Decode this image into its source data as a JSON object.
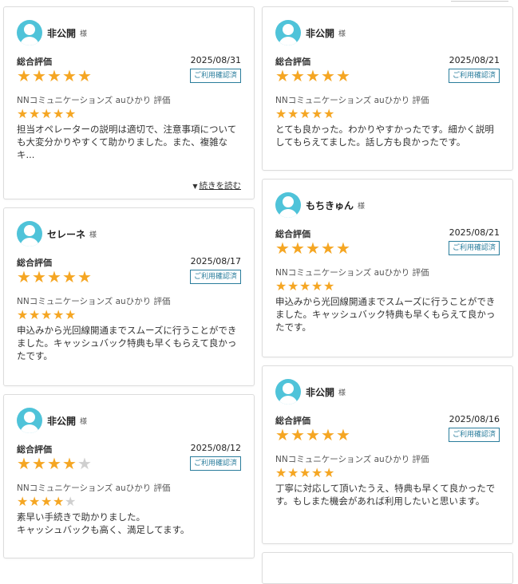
{
  "honorific": "様",
  "overall_label": "総合評価",
  "confirmed_badge": "ご利用確認済",
  "service_rating_label": "NNコミュニケーションズ auひかり 評価",
  "read_more": "続きを読む",
  "star_color": "#f5a623",
  "avatar_color": "#4fc3d9",
  "reviews": [
    {
      "name": "非公開",
      "date": "2025/08/31",
      "overall": 5,
      "service": 5,
      "comment": "担当オペレーターの説明は適切で、注意事項についても大変分かりやすくて助かりました。また、複雑なキ..."
    },
    {
      "name": "非公開",
      "date": "2025/08/21",
      "overall": 5,
      "service": 5,
      "comment": "とても良かった。わかりやすかったです。細かく説明してもらえてました。話し方も良かったです。"
    },
    {
      "name": "セレーネ",
      "date": "2025/08/17",
      "overall": 5,
      "service": 5,
      "comment": "申込みから光回線開通までスムーズに行うことができました。キャッシュバック特典も早くもらえて良かったです。"
    },
    {
      "name": "もちきゅん",
      "date": "2025/08/21",
      "overall": 5,
      "service": 5,
      "comment": "申込みから光回線開通までスムーズに行うことができました。キャッシュバック特典も早くもらえて良かったです。"
    },
    {
      "name": "非公開",
      "date": "2025/08/12",
      "overall": 4,
      "service": 4,
      "comment": "素早い手続きで助かりました。\nキャッシュバックも高く、満足してます。"
    },
    {
      "name": "非公開",
      "date": "2025/08/16",
      "overall": 5,
      "service": 5,
      "comment": "丁寧に対応して頂いたうえ、特典も早くて良かったです。もしまた機会があれば利用したいと思います。"
    }
  ]
}
